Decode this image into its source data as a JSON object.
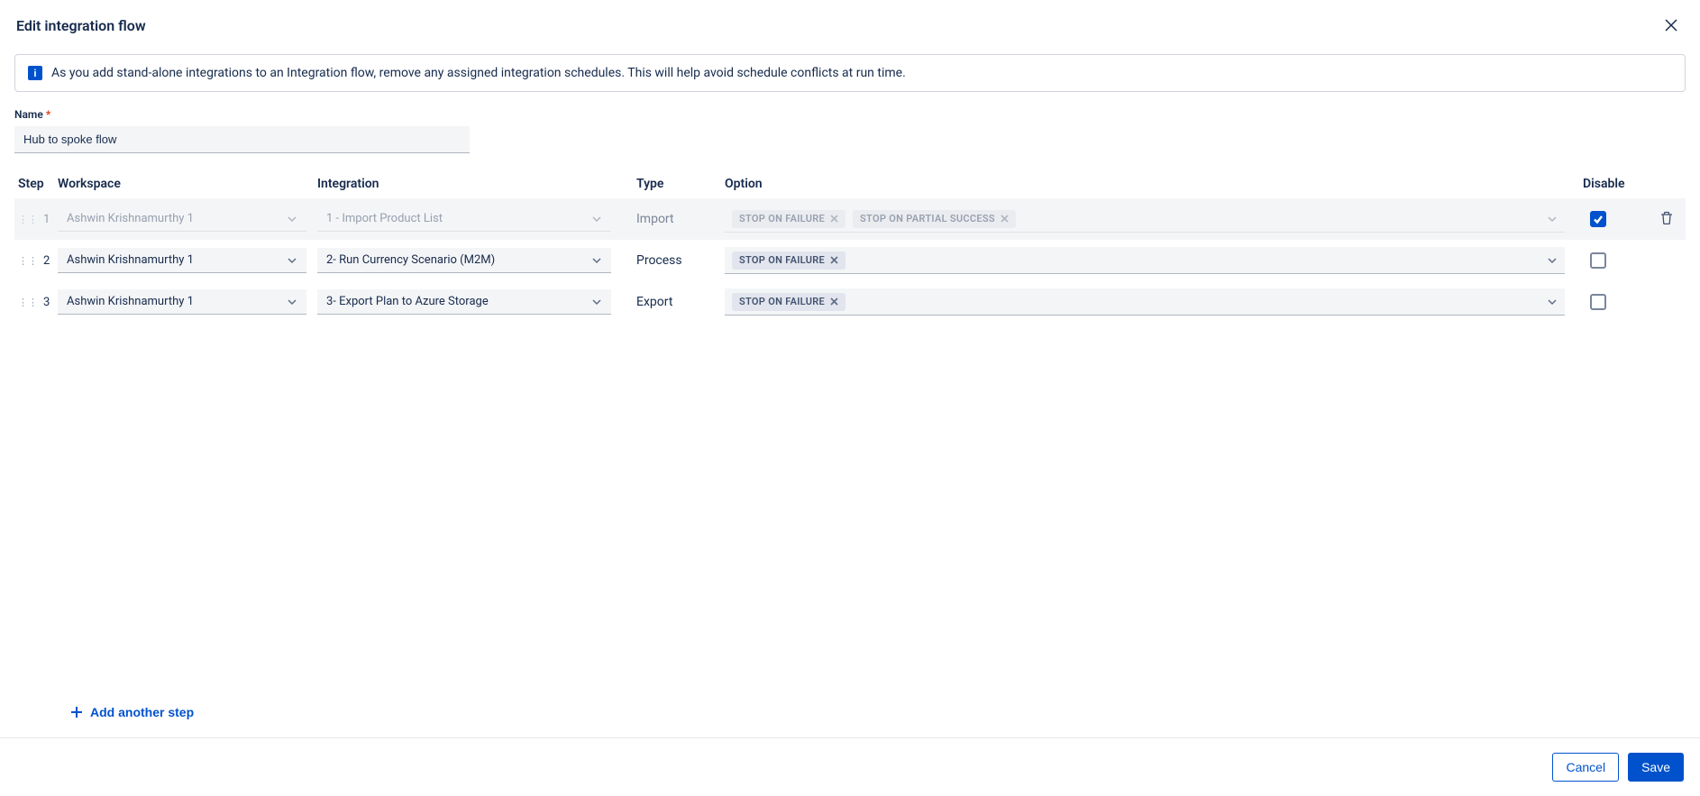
{
  "header": {
    "title": "Edit integration flow"
  },
  "banner": {
    "text": "As you add stand-alone integrations to an Integration flow, remove any assigned integration schedules. This will help avoid schedule conflicts at run time."
  },
  "form": {
    "name_label": "Name",
    "name_value": "Hub to spoke flow"
  },
  "table": {
    "headers": {
      "step": "Step",
      "workspace": "Workspace",
      "integration": "Integration",
      "type": "Type",
      "option": "Option",
      "disable": "Disable"
    },
    "rows": [
      {
        "step": "1",
        "workspace": "Ashwin Krishnamurthy 1",
        "integration": "1 - Import Product List",
        "type": "Import",
        "options": [
          "STOP ON FAILURE",
          "STOP ON PARTIAL SUCCESS"
        ],
        "disabled": true
      },
      {
        "step": "2",
        "workspace": "Ashwin Krishnamurthy 1",
        "integration": "2- Run Currency Scenario (M2M)",
        "type": "Process",
        "options": [
          "STOP ON FAILURE"
        ],
        "disabled": false
      },
      {
        "step": "3",
        "workspace": "Ashwin Krishnamurthy 1",
        "integration": "3- Export Plan to Azure Storage",
        "type": "Export",
        "options": [
          "STOP ON FAILURE"
        ],
        "disabled": false
      }
    ]
  },
  "actions": {
    "add_step": "Add another step",
    "cancel": "Cancel",
    "save": "Save"
  }
}
